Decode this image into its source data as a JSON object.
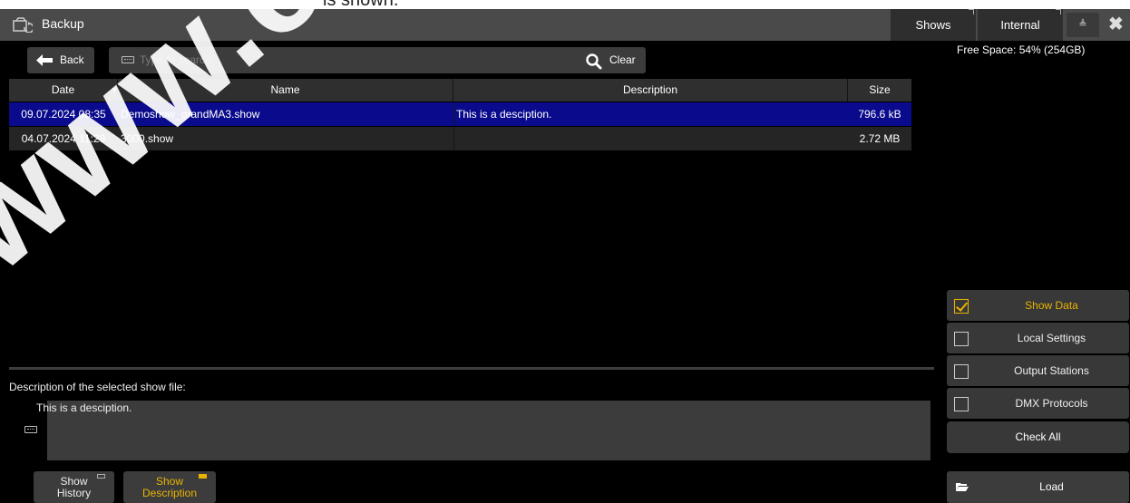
{
  "page": {
    "top_cut_text": "is shown."
  },
  "titlebar": {
    "title": "Backup",
    "shows_label": "Shows",
    "internal_label": "Internal",
    "eject_glyph": "≜",
    "close_glyph": "✖"
  },
  "toolbar": {
    "back_label": "Back",
    "search_placeholder": "Type to search...",
    "search_value": "",
    "clear_label": "Clear"
  },
  "free_space": "Free Space: 54% (254GB)",
  "table": {
    "columns": {
      "date": "Date",
      "name": "Name",
      "description": "Description",
      "size": "Size"
    },
    "sort_glyph": "▼",
    "rows": [
      {
        "date": "09.07.2024 08:35",
        "name": "Demoshow_grandMA3.show",
        "description": "This is a desciption.",
        "size": "796.6 kB",
        "selected": true
      },
      {
        "date": "04.07.2024 11:29",
        "name": "3000.show",
        "description": "",
        "size": "2.72 MB",
        "selected": false
      }
    ]
  },
  "description": {
    "label": "Description of the selected show file:",
    "text": "This is a desciption."
  },
  "bottom": {
    "show_history_line1": "Show",
    "show_history_line2": "History",
    "show_description_line1": "Show",
    "show_description_line2": "Description"
  },
  "options": [
    {
      "label": "Show Data",
      "checked": true
    },
    {
      "label": "Local Settings",
      "checked": false
    },
    {
      "label": "Output Stations",
      "checked": false
    },
    {
      "label": "DMX Protocols",
      "checked": false
    }
  ],
  "check_all_label": "Check All",
  "load_label": "Load",
  "watermark": "www.carlos",
  "colors": {
    "accent": "#e8b400",
    "selected_row": "#0a0a8c",
    "panel": "#3c3c3c",
    "titlebar": "#4a4a4a"
  }
}
